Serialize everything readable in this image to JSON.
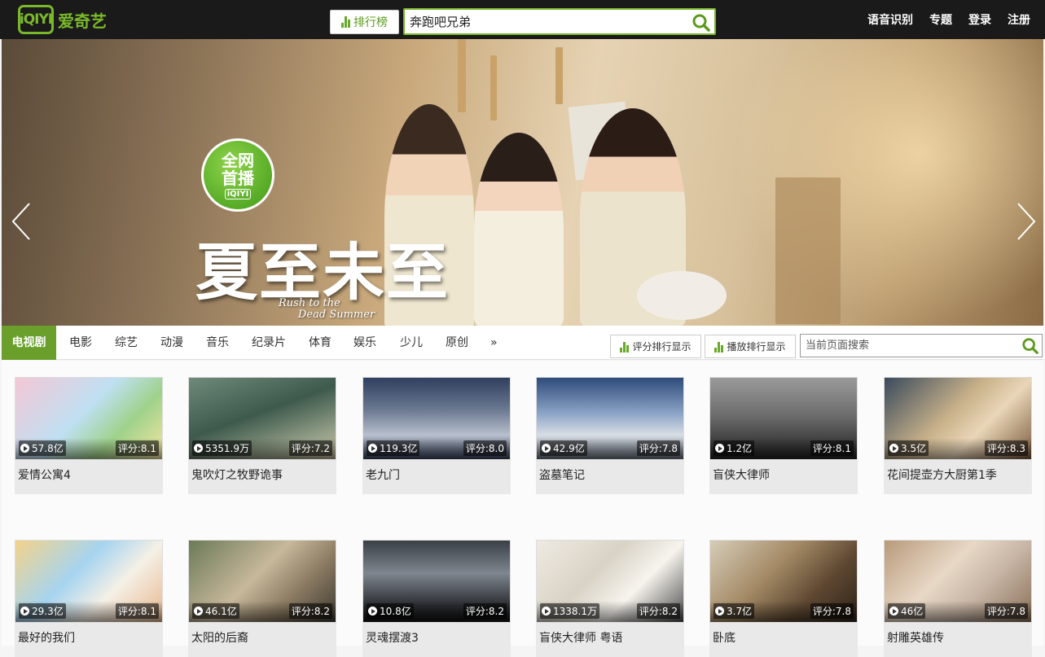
{
  "header": {
    "logo_mark": "iQIYI",
    "logo_text": "爱奇艺",
    "rank_button": "排行榜",
    "search_value": "奔跑吧兄弟",
    "links": [
      "语音识别",
      "专题",
      "登录",
      "注册"
    ]
  },
  "banner": {
    "badge_line1": "全网",
    "badge_line2": "首播",
    "badge_mark": "iQIYI",
    "title": "夏至未至",
    "subtitle_line1": "Rush to the",
    "subtitle_line2": "Dead Summer"
  },
  "categories": [
    "电视剧",
    "电影",
    "综艺",
    "动漫",
    "音乐",
    "纪录片",
    "体育",
    "娱乐",
    "少儿",
    "原创",
    "»"
  ],
  "toolbar": {
    "rating_sort": "评分排行显示",
    "play_sort": "播放排行显示",
    "page_search_placeholder": "当前页面搜索"
  },
  "shows": [
    {
      "title": "爱情公寓4",
      "plays": "57.8亿",
      "rating": "评分:8.1"
    },
    {
      "title": "鬼吹灯之牧野诡事",
      "plays": "5351.9万",
      "rating": "评分:7.2"
    },
    {
      "title": "老九门",
      "plays": "119.3亿",
      "rating": "评分:8.0"
    },
    {
      "title": "盗墓笔记",
      "plays": "42.9亿",
      "rating": "评分:7.8"
    },
    {
      "title": "盲侠大律师",
      "plays": "1.2亿",
      "rating": "评分:8.1"
    },
    {
      "title": "花间提壶方大厨第1季",
      "plays": "3.5亿",
      "rating": "评分:8.3"
    },
    {
      "title": "最好的我们",
      "plays": "29.3亿",
      "rating": "评分:8.1"
    },
    {
      "title": "太阳的后裔",
      "plays": "46.1亿",
      "rating": "评分:8.2"
    },
    {
      "title": "灵魂摆渡3",
      "plays": "10.8亿",
      "rating": "评分:8.2"
    },
    {
      "title": "盲侠大律师 粤语",
      "plays": "1338.1万",
      "rating": "评分:8.2"
    },
    {
      "title": "卧底",
      "plays": "3.7亿",
      "rating": "评分:7.8"
    },
    {
      "title": "射雕英雄传",
      "plays": "46亿",
      "rating": "评分:7.8"
    }
  ],
  "colors": {
    "brand_green": "#7ab82b",
    "active_tab": "#699f2a",
    "topbar": "#1a1a1a"
  }
}
